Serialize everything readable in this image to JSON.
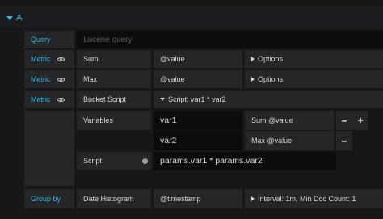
{
  "query_row": {
    "header_label": "A",
    "query_label": "Query",
    "query_placeholder": "Lucene query"
  },
  "metrics": [
    {
      "label": "Metric",
      "type": "Sum",
      "field": "@value",
      "options": "Options"
    },
    {
      "label": "Metric",
      "type": "Max",
      "field": "@value",
      "options": "Options"
    },
    {
      "label": "Metric",
      "type": "Bucket Script",
      "script_toggle": "Script: var1 * var2"
    }
  ],
  "bucket_script": {
    "variables_label": "Variables",
    "variables": [
      {
        "name": "var1",
        "metric": "Sum @value"
      },
      {
        "name": "var2",
        "metric": "Max @value"
      }
    ],
    "remove_symbol": "–",
    "add_symbol": "+",
    "script_label": "Script",
    "info_symbol": "i",
    "script_value": "params.var1 * params.var2"
  },
  "group_by": {
    "label": "Group by",
    "type": "Date Histogram",
    "field": "@timestamp",
    "interval": "Interval: 1m, Min Doc Count: 1"
  }
}
